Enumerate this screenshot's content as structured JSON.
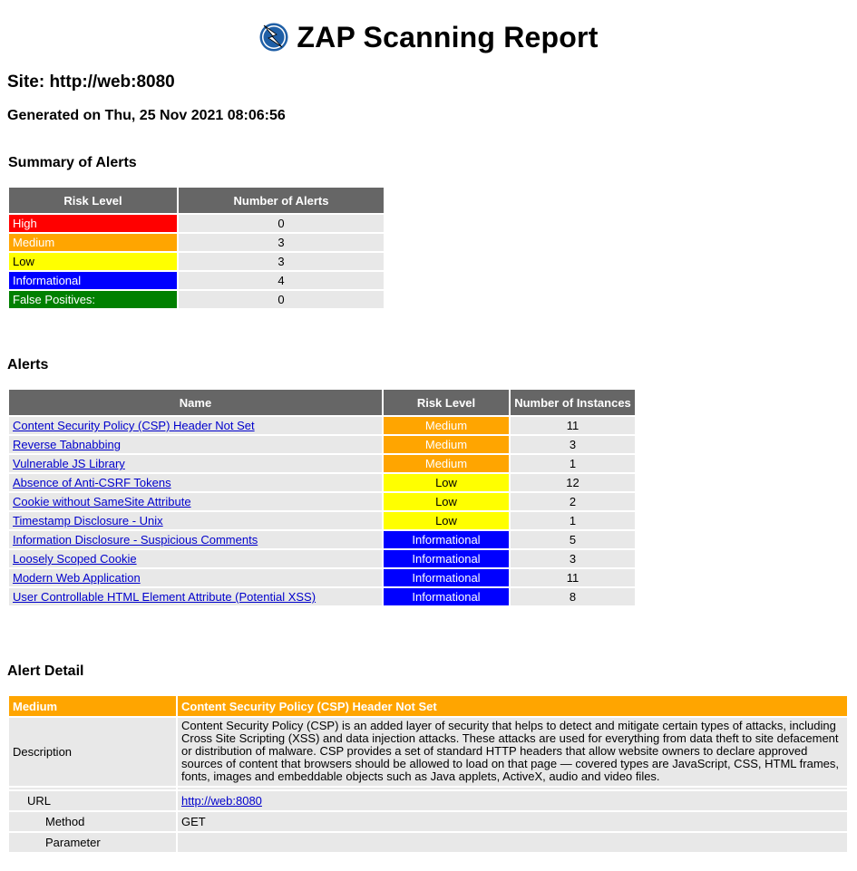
{
  "report": {
    "title": "ZAP Scanning Report",
    "site_heading": "Site: http://web:8080",
    "generated": "Generated on Thu, 25 Nov 2021 08:06:56"
  },
  "summary": {
    "heading": "Summary of Alerts",
    "col_risk": "Risk Level",
    "col_count": "Number of Alerts",
    "rows": [
      {
        "label": "High",
        "count": "0",
        "color": "#ff0000"
      },
      {
        "label": "Medium",
        "count": "3",
        "color": "#ffa500"
      },
      {
        "label": "Low",
        "count": "3",
        "color": "#ffff00"
      },
      {
        "label": "Informational",
        "count": "4",
        "color": "#0000ff"
      },
      {
        "label": "False Positives:",
        "count": "0",
        "color": "#008000"
      }
    ]
  },
  "alerts": {
    "heading": "Alerts",
    "col_name": "Name",
    "col_risk": "Risk Level",
    "col_instances": "Number of Instances",
    "rows": [
      {
        "name": "Content Security Policy (CSP) Header Not Set",
        "risk": "Medium",
        "instances": "11"
      },
      {
        "name": "Reverse Tabnabbing",
        "risk": "Medium",
        "instances": "3"
      },
      {
        "name": "Vulnerable JS Library",
        "risk": "Medium",
        "instances": "1"
      },
      {
        "name": "Absence of Anti-CSRF Tokens",
        "risk": "Low",
        "instances": "12"
      },
      {
        "name": "Cookie without SameSite Attribute",
        "risk": "Low",
        "instances": "2"
      },
      {
        "name": "Timestamp Disclosure - Unix",
        "risk": "Low",
        "instances": "1"
      },
      {
        "name": "Information Disclosure - Suspicious Comments",
        "risk": "Informational",
        "instances": "5"
      },
      {
        "name": "Loosely Scoped Cookie",
        "risk": "Informational",
        "instances": "3"
      },
      {
        "name": "Modern Web Application",
        "risk": "Informational",
        "instances": "11"
      },
      {
        "name": "User Controllable HTML Element Attribute (Potential XSS)",
        "risk": "Informational",
        "instances": "8"
      }
    ]
  },
  "detail": {
    "heading": "Alert Detail",
    "risk": "Medium",
    "name": "Content Security Policy (CSP) Header Not Set",
    "description_label": "Description",
    "description": "Content Security Policy (CSP) is an added layer of security that helps to detect and mitigate certain types of attacks, including Cross Site Scripting (XSS) and data injection attacks. These attacks are used for everything from data theft to site defacement or distribution of malware. CSP provides a set of standard HTTP headers that allow website owners to declare approved sources of content that browsers should be allowed to load on that page — covered types are JavaScript, CSS, HTML frames, fonts, images and embeddable objects such as Java applets, ActiveX, audio and video files.",
    "url_label": "URL",
    "url_value": "http://web:8080",
    "method_label": "Method",
    "method_value": "GET",
    "parameter_label": "Parameter",
    "parameter_value": ""
  },
  "colors": {
    "header_grey": "#666666",
    "cell_grey": "#e8e8e8",
    "high": "#ff0000",
    "medium": "#ffa500",
    "low": "#ffff00",
    "informational": "#0000ff",
    "false_positive": "#008000"
  }
}
